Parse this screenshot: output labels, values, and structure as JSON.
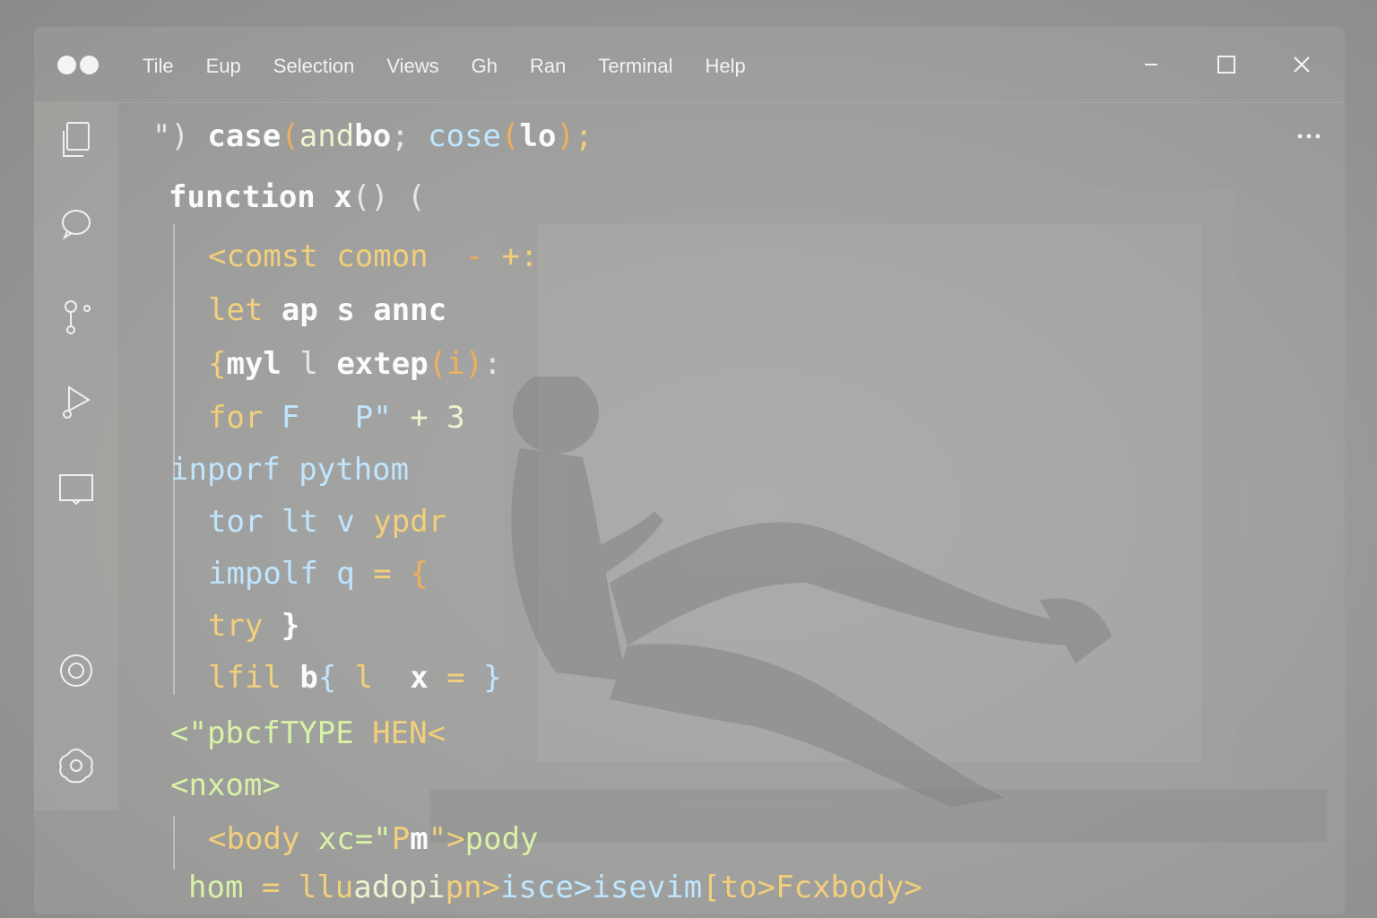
{
  "colors": {
    "keyword": "#fbfbf9",
    "string": "#f2cf7a",
    "function": "#bfe6ff",
    "variable": "#eef3d0",
    "html": "#d7f3a6",
    "accent_orange": "#f0b05a",
    "punct": "#e6e6e4"
  },
  "menu": {
    "items": [
      "Tile",
      "Eup",
      "Selection",
      "Views",
      "Gh",
      "Ran",
      "Terminal",
      "Help"
    ]
  },
  "activity_icons": [
    "files-icon",
    "search-icon",
    "source-control-icon",
    "run-debug-icon",
    "extensions-icon",
    "account-icon",
    "settings-icon"
  ],
  "editor": {
    "lines": [
      {
        "parts": [
          {
            "t": "\") ",
            "c": "punct"
          },
          {
            "t": "case",
            "c": "keyword"
          },
          {
            "t": "(",
            "c": "accent_orange"
          },
          {
            "t": "and",
            "c": "variable"
          },
          {
            "t": "bo",
            "c": "keyword"
          },
          {
            "t": "; ",
            "c": "punct"
          },
          {
            "t": "cose",
            "c": "function"
          },
          {
            "t": "(",
            "c": "accent_orange"
          },
          {
            "t": "lo",
            "c": "keyword"
          },
          {
            "t": ")",
            "c": "accent_orange"
          },
          {
            "t": ";",
            "c": "string"
          }
        ]
      },
      {
        "parts": [
          {
            "t": "function ",
            "c": "keyword"
          },
          {
            "t": "x",
            "c": "keyword"
          },
          {
            "t": "() (",
            "c": "punct"
          }
        ]
      },
      {
        "parts": [
          {
            "t": "<comst ",
            "c": "string"
          },
          {
            "t": "comon ",
            "c": "string"
          },
          {
            "t": " - ",
            "c": "accent_orange"
          },
          {
            "t": "+:",
            "c": "string"
          }
        ]
      },
      {
        "parts": [
          {
            "t": "let ",
            "c": "string"
          },
          {
            "t": "ap ",
            "c": "keyword"
          },
          {
            "t": "s ",
            "c": "keyword"
          },
          {
            "t": "annc",
            "c": "keyword"
          }
        ]
      },
      {
        "parts": [
          {
            "t": "{",
            "c": "string"
          },
          {
            "t": "myl ",
            "c": "keyword"
          },
          {
            "t": "l ",
            "c": "punct"
          },
          {
            "t": "extep",
            "c": "keyword"
          },
          {
            "t": "(i)",
            "c": "accent_orange"
          },
          {
            "t": ":",
            "c": "punct"
          }
        ]
      },
      {
        "parts": [
          {
            "t": "for ",
            "c": "string"
          },
          {
            "t": "F   ",
            "c": "function"
          },
          {
            "t": "P\" ",
            "c": "function"
          },
          {
            "t": "+ ",
            "c": "variable"
          },
          {
            "t": "3",
            "c": "variable"
          }
        ]
      },
      {
        "parts": [
          {
            "t": "inporf ",
            "c": "function"
          },
          {
            "t": "pythom",
            "c": "function"
          }
        ]
      },
      {
        "parts": [
          {
            "t": "tor ",
            "c": "function"
          },
          {
            "t": "lt ",
            "c": "function"
          },
          {
            "t": "v ",
            "c": "function"
          },
          {
            "t": "ypdr",
            "c": "string"
          }
        ]
      },
      {
        "parts": [
          {
            "t": "impolf ",
            "c": "function"
          },
          {
            "t": "q ",
            "c": "function"
          },
          {
            "t": "= ",
            "c": "string"
          },
          {
            "t": "{",
            "c": "accent_orange"
          }
        ]
      },
      {
        "parts": [
          {
            "t": "try ",
            "c": "string"
          },
          {
            "t": "}",
            "c": "keyword"
          }
        ]
      },
      {
        "parts": [
          {
            "t": "lfil ",
            "c": "string"
          },
          {
            "t": "b",
            "c": "keyword"
          },
          {
            "t": "{ ",
            "c": "function"
          },
          {
            "t": "l ",
            "c": "string"
          },
          {
            "t": " x ",
            "c": "keyword"
          },
          {
            "t": "= ",
            "c": "string"
          },
          {
            "t": "}",
            "c": "function"
          }
        ]
      },
      {
        "parts": [
          {
            "t": "<\"pbcfTYPE ",
            "c": "html"
          },
          {
            "t": "HEN<",
            "c": "string"
          }
        ]
      },
      {
        "parts": [
          {
            "t": "<nxom>",
            "c": "html"
          }
        ]
      },
      {
        "parts": [
          {
            "t": "<body ",
            "c": "string"
          },
          {
            "t": "xc=\"",
            "c": "html"
          },
          {
            "t": "P",
            "c": "string"
          },
          {
            "t": "m",
            "c": "keyword"
          },
          {
            "t": "\">",
            "c": "string"
          },
          {
            "t": "pody",
            "c": "html"
          }
        ]
      },
      {
        "parts": [
          {
            "t": "hom ",
            "c": "html"
          },
          {
            "t": "= ",
            "c": "string"
          },
          {
            "t": "llu",
            "c": "string"
          },
          {
            "t": "adopi",
            "c": "variable"
          },
          {
            "t": "pn>",
            "c": "string"
          },
          {
            "t": "isce>",
            "c": "function"
          },
          {
            "t": "isevim",
            "c": "function"
          },
          {
            "t": "[to>",
            "c": "string"
          },
          {
            "t": "Fcxbody>",
            "c": "string"
          }
        ]
      }
    ]
  }
}
